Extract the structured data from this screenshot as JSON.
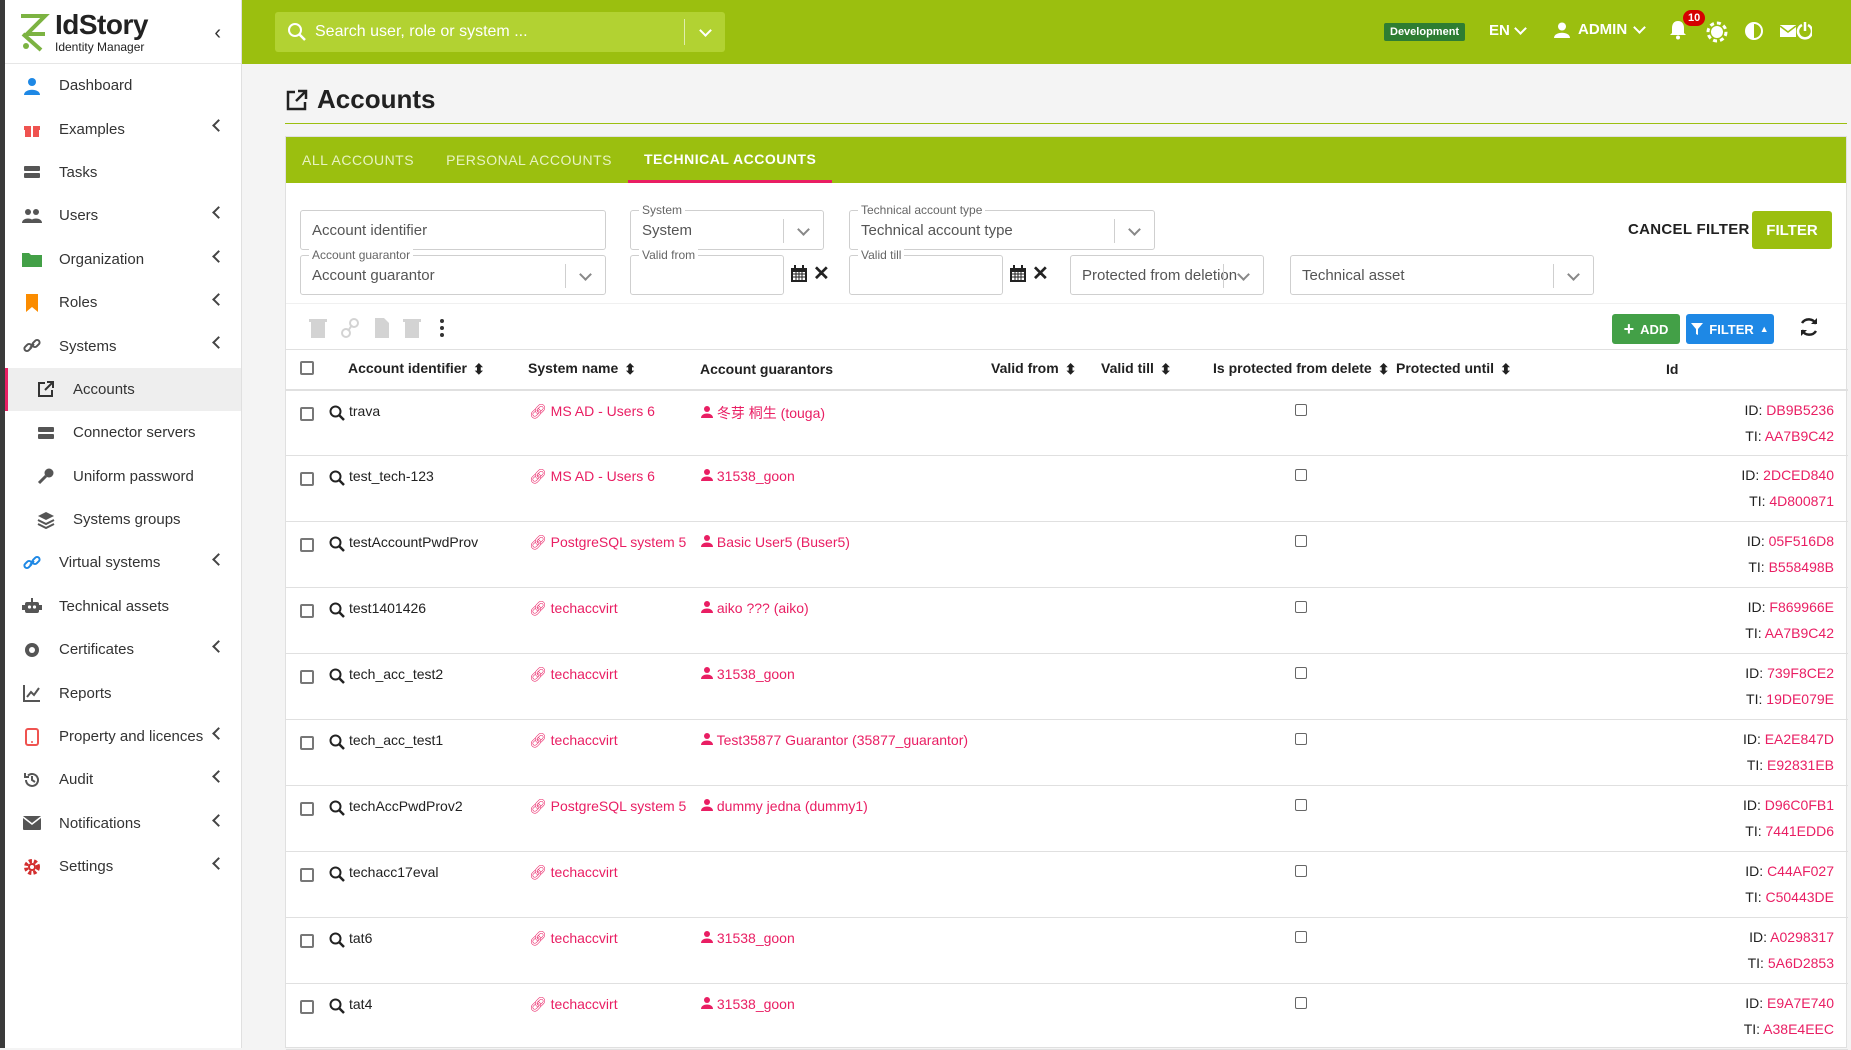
{
  "app": {
    "name": "IdStory",
    "subtitle": "Identity Manager"
  },
  "sidebar": {
    "items": [
      {
        "label": "Dashboard",
        "icon": "user-icon"
      },
      {
        "label": "Examples",
        "icon": "gift-icon"
      },
      {
        "label": "Tasks",
        "icon": "tasks-icon"
      },
      {
        "label": "Users",
        "icon": "users-icon"
      },
      {
        "label": "Organization",
        "icon": "folder-icon"
      },
      {
        "label": "Roles",
        "icon": "bookmark-icon"
      },
      {
        "label": "Systems",
        "icon": "link-icon"
      },
      {
        "label": "Accounts",
        "icon": "external-link-icon"
      },
      {
        "label": "Connector servers",
        "icon": "server-icon"
      },
      {
        "label": "Uniform password",
        "icon": "key-icon"
      },
      {
        "label": "Systems groups",
        "icon": "layers-icon"
      },
      {
        "label": "Virtual systems",
        "icon": "link-icon"
      },
      {
        "label": "Technical assets",
        "icon": "robot-icon"
      },
      {
        "label": "Certificates",
        "icon": "certificate-icon"
      },
      {
        "label": "Reports",
        "icon": "chart-icon"
      },
      {
        "label": "Property and licences",
        "icon": "phone-icon"
      },
      {
        "label": "Audit",
        "icon": "history-icon"
      },
      {
        "label": "Notifications",
        "icon": "envelope-icon"
      },
      {
        "label": "Settings",
        "icon": "gear-icon"
      }
    ]
  },
  "topbar": {
    "search_placeholder": "Search user, role or system ...",
    "environment": "Development",
    "language": "EN",
    "user": "ADMIN",
    "notification_count": "10"
  },
  "page": {
    "title": "Accounts"
  },
  "tabs": [
    "ALL ACCOUNTS",
    "PERSONAL ACCOUNTS",
    "TECHNICAL ACCOUNTS"
  ],
  "filters": {
    "account_identifier": "Account identifier",
    "system_label": "System",
    "system_value": "System",
    "type_label": "Technical account type",
    "type_value": "Technical account type",
    "guarantor_label": "Account guarantor",
    "guarantor_value": "Account guarantor",
    "valid_from_label": "Valid from",
    "valid_till_label": "Valid till",
    "protected": "Protected from deletion",
    "asset": "Technical asset",
    "cancel": "CANCEL FILTER",
    "apply": "FILTER"
  },
  "toolbar": {
    "add": "ADD",
    "filter": "FILTER"
  },
  "table": {
    "columns": [
      "Account identifier",
      "System name",
      "Account guarantors",
      "Valid from",
      "Valid till",
      "Is protected from delete",
      "Protected until",
      "Id"
    ],
    "rows": [
      {
        "identifier": "trava",
        "system": "MS AD - Users 6",
        "guarantor": "冬芽 桐生 (touga)",
        "id": "DB9B5236",
        "ti": "AA7B9C42"
      },
      {
        "identifier": "test_tech-123",
        "system": "MS AD - Users 6",
        "guarantor": "31538_goon",
        "id": "2DCED840",
        "ti": "4D800871"
      },
      {
        "identifier": "testAccountPwdProv",
        "system": "PostgreSQL system 5",
        "guarantor": "Basic User5 (Buser5)",
        "id": "05F516D8",
        "ti": "B558498B"
      },
      {
        "identifier": "test1401426",
        "system": "techaccvirt",
        "guarantor": "aiko ??? (aiko)",
        "id": "F869966E",
        "ti": "AA7B9C42"
      },
      {
        "identifier": "tech_acc_test2",
        "system": "techaccvirt",
        "guarantor": "31538_goon",
        "id": "739F8CE2",
        "ti": "19DE079E"
      },
      {
        "identifier": "tech_acc_test1",
        "system": "techaccvirt",
        "guarantor": "Test35877 Guarantor (35877_guarantor)",
        "id": "EA2E847D",
        "ti": "E92831EB"
      },
      {
        "identifier": "techAccPwdProv2",
        "system": "PostgreSQL system 5",
        "guarantor": "dummy jedna (dummy1)",
        "id": "D96C0FB1",
        "ti": "7441EDD6"
      },
      {
        "identifier": "techacc17eval",
        "system": "techaccvirt",
        "guarantor": "",
        "id": "C44AF027",
        "ti": "C50443DE"
      },
      {
        "identifier": "tat6",
        "system": "techaccvirt",
        "guarantor": "31538_goon",
        "id": "A0298317",
        "ti": "5A6D2853"
      },
      {
        "identifier": "tat4",
        "system": "techaccvirt",
        "guarantor": "31538_goon",
        "id": "E9A7E740",
        "ti": "A38E4EEC"
      }
    ]
  },
  "colors": {
    "brand": "#9bbf0f",
    "link": "#e91e63",
    "add": "#43a047",
    "filter": "#1e88e5"
  }
}
